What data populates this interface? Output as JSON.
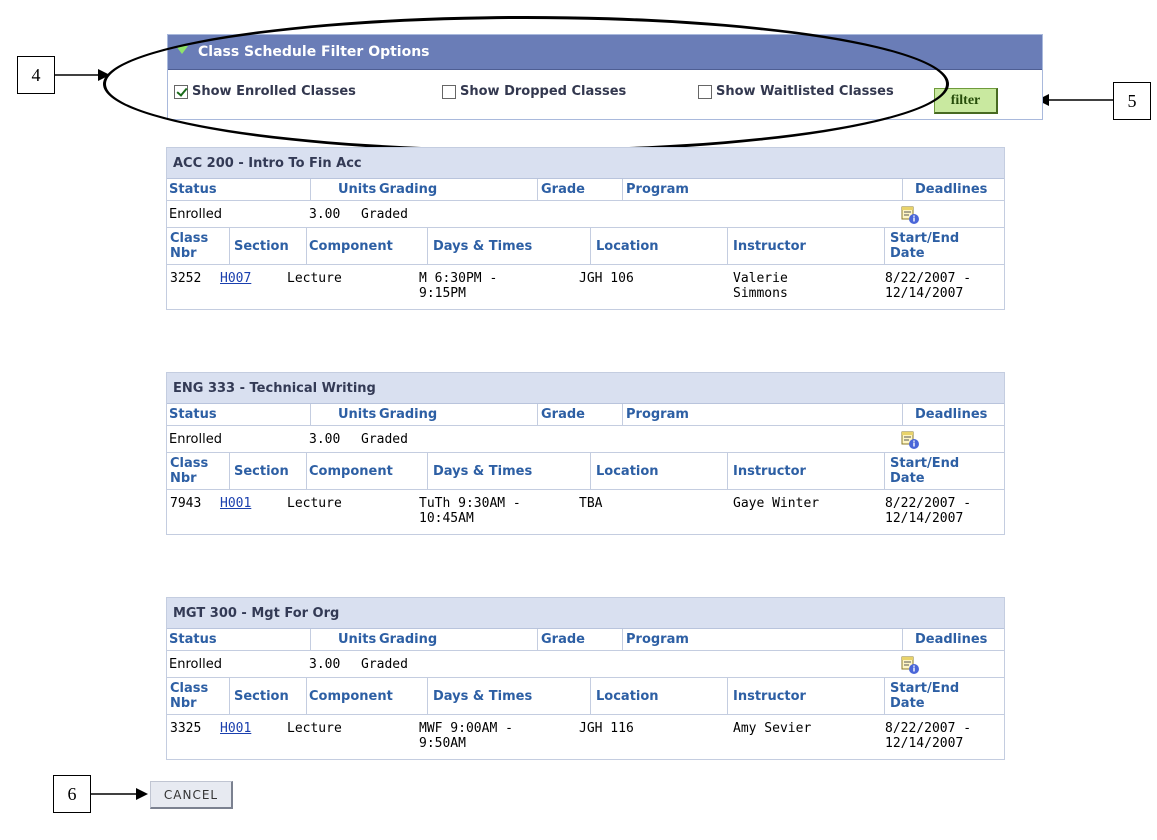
{
  "callouts": {
    "c4": "4",
    "c5": "5",
    "c6": "6"
  },
  "filter": {
    "title": "Class Schedule Filter Options",
    "enrolled_label": "Show Enrolled Classes",
    "enrolled_checked": true,
    "dropped_label": "Show Dropped Classes",
    "dropped_checked": false,
    "waitlisted_label": "Show Waitlisted Classes",
    "waitlisted_checked": false,
    "button_label": "filter"
  },
  "headers": {
    "status": "Status",
    "units": "Units",
    "grading": "Grading",
    "grade": "Grade",
    "program": "Program",
    "deadlines": "Deadlines",
    "class_nbr_1": "Class",
    "class_nbr_2": "Nbr",
    "section": "Section",
    "component": "Component",
    "days_times": "Days & Times",
    "location": "Location",
    "instructor": "Instructor",
    "start_end_1": "Start/End",
    "start_end_2": "Date"
  },
  "classes": [
    {
      "title": "ACC 200 - Intro To Fin Acc",
      "status": "Enrolled",
      "units": "3.00",
      "grading": "Graded",
      "class_nbr": "3252",
      "section": "H007",
      "component": "Lecture",
      "days_times_1": "M 6:30PM -",
      "days_times_2": "9:15PM",
      "location": "JGH 106",
      "instructor_1": "Valerie",
      "instructor_2": "Simmons",
      "dates_1": "8/22/2007 -",
      "dates_2": "12/14/2007"
    },
    {
      "title": "ENG 333 - Technical Writing",
      "status": "Enrolled",
      "units": "3.00",
      "grading": "Graded",
      "class_nbr": "7943",
      "section": "H001",
      "component": "Lecture",
      "days_times_1": "TuTh 9:30AM -",
      "days_times_2": "10:45AM",
      "location": "TBA",
      "instructor_1": "Gaye Winter",
      "instructor_2": "",
      "dates_1": "8/22/2007 -",
      "dates_2": "12/14/2007"
    },
    {
      "title": "MGT 300 - Mgt For Org",
      "status": "Enrolled",
      "units": "3.00",
      "grading": "Graded",
      "class_nbr": "3325",
      "section": "H001",
      "component": "Lecture",
      "days_times_1": "MWF 9:00AM -",
      "days_times_2": "9:50AM",
      "location": "JGH 116",
      "instructor_1": "Amy Sevier",
      "instructor_2": "",
      "dates_1": "8/22/2007 -",
      "dates_2": "12/14/2007"
    }
  ],
  "cancel_label": "CANCEL"
}
